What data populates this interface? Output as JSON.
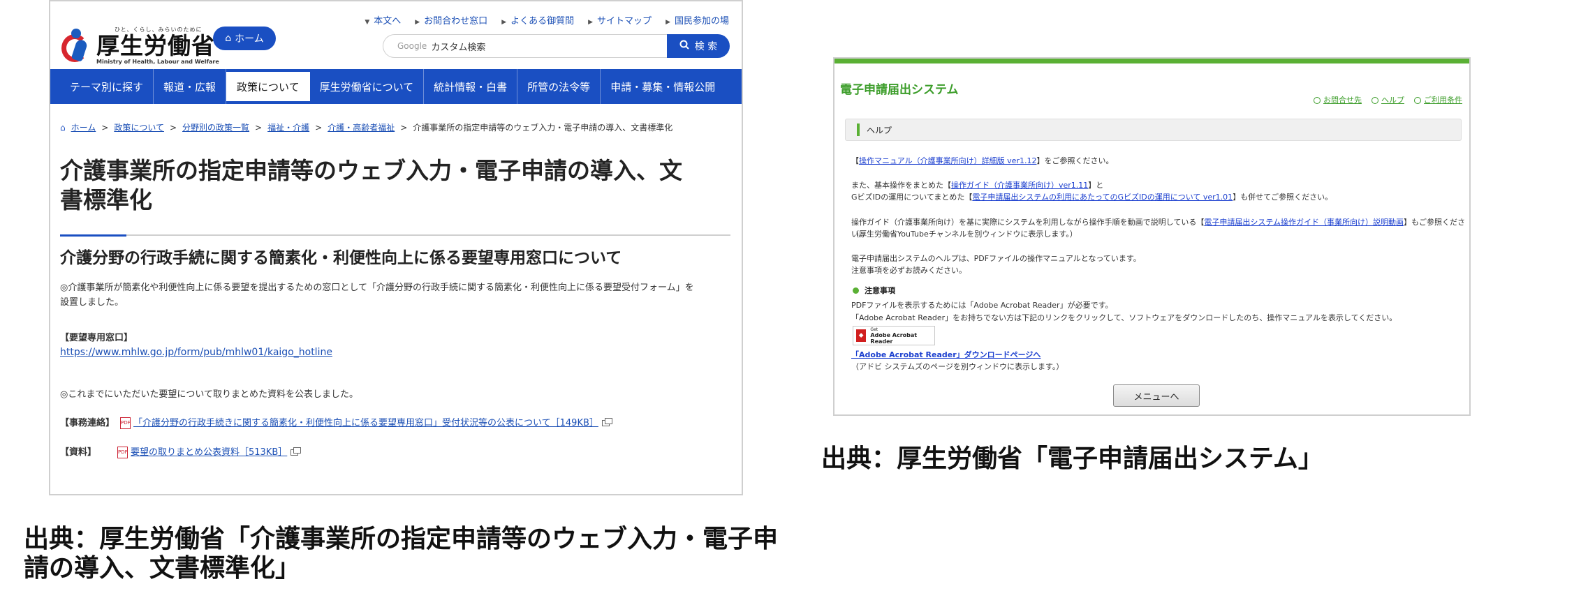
{
  "left": {
    "logo": {
      "tagline": "ひと、くらし、みらいのために",
      "name": "厚生労働省",
      "english": "Ministry of Health, Labour and Welfare"
    },
    "home_button": "ホーム",
    "util_links": [
      "本文へ",
      "お問合わせ窓口",
      "よくある御質問",
      "サイトマップ",
      "国民参加の場"
    ],
    "search": {
      "google": "Google",
      "placeholder": "カスタム検索",
      "button": "検 索"
    },
    "nav": [
      "テーマ別に探す",
      "報道・広報",
      "政策について",
      "厚生労働省について",
      "統計情報・白書",
      "所管の法令等",
      "申請・募集・情報公開"
    ],
    "nav_active_index": 2,
    "breadcrumb": [
      "ホーム",
      "政策について",
      "分野別の政策一覧",
      "福祉・介護",
      "介護・高齢者福祉",
      "介護事業所の指定申請等のウェブ入力・電子申請の導入、文書標準化"
    ],
    "title_line1": "介護事業所の指定申請等のウェブ入力・電子申請の導入、文",
    "title_line2": "書標準化",
    "section_heading": "介護分野の行政手続に関する簡素化・利便性向上に係る要望専用窓口について",
    "intro_line1": "◎介護事業所が簡素化や利便性向上に係る要望を提出するための窓口として「介護分野の行政手続に関する簡素化・利便性向上に係る要望受付フォーム」を",
    "intro_line2": "設置しました。",
    "window_label": "【要望専用窓口】",
    "window_url": "https://www.mhlw.go.jp/form/pub/mhlw01/kaigo_hotline",
    "published_note": "◎これまでにいただいた要望について取りまとめた資料を公表しました。",
    "contact_label": "【事務連絡】",
    "contact_link": "「介護分野の行政手続きに関する簡素化・利便性向上に係る要望専用窓口」受付状況等の公表について［149KB］",
    "material_label": "【資料】",
    "material_link": "要望の取りまとめ公表資料［513KB］",
    "pdf_text": "PDF"
  },
  "right": {
    "system_title": "電子申請届出システム",
    "top_links": [
      "お問合せ先",
      "ヘルプ",
      "ご利用条件"
    ],
    "help_heading": "ヘルプ",
    "l1_pre": "【",
    "l1_link": "操作マニュアル（介護事業所向け）詳細版 ver1.12",
    "l1_post": "】をご参照ください。",
    "l2_pre": "また、基本操作をまとめた【",
    "l2_link": "操作ガイド（介護事業所向け）ver1.11",
    "l2_post": "】と",
    "l3_pre": "GビズIDの運用についてまとめた【",
    "l3_link": "電子申請届出システムの利用にあたってのGビズIDの運用について ver1.01",
    "l3_post": "】も併せてご参照ください。",
    "l4_pre": "操作ガイド（介護事業所向け）を基に実際にシステムを利用しながら操作手順を動画で説明している【",
    "l4_link": "電子申請届出システム操作ガイド（事業所向け）説明動画",
    "l4_post": "】もご参照ください。",
    "l5": "（厚生労働省YouTubeチャンネルを別ウィンドウに表示します。）",
    "l6": "電子申請届出システムのヘルプは、PDFファイルの操作マニュアルとなっています。",
    "l7": "注意事項を必ずお読みください。",
    "notice_heading": "注意事項",
    "n1": "PDFファイルを表示するためには「Adobe Acrobat Reader」が必要です。",
    "n2": "「Adobe Acrobat Reader」をお持ちでない方は下記のリンクをクリックして、ソフトウェアをダウンロードしたのち、操作マニュアルを表示してください。",
    "acrobat_get": "Get",
    "acrobat_name": "Adobe Acrobat Reader",
    "download_link": "「Adobe Acrobat Reader」ダウンロードページへ",
    "adobe_note": "（アドビ システムズのページを別ウィンドウに表示します。）",
    "menu_button": "メニューへ"
  },
  "captions": {
    "left_line1": "出典：厚生労働省「介護事業所の指定申請等のウェブ入力・電子申",
    "left_line2": "請の導入、文書標準化」",
    "right": "出典：厚生労働省「電子申請届出システム」"
  },
  "colors": {
    "mhlw_blue": "#1a4fc2",
    "system_green": "#5ab034",
    "logo_red": "#d7262e"
  }
}
